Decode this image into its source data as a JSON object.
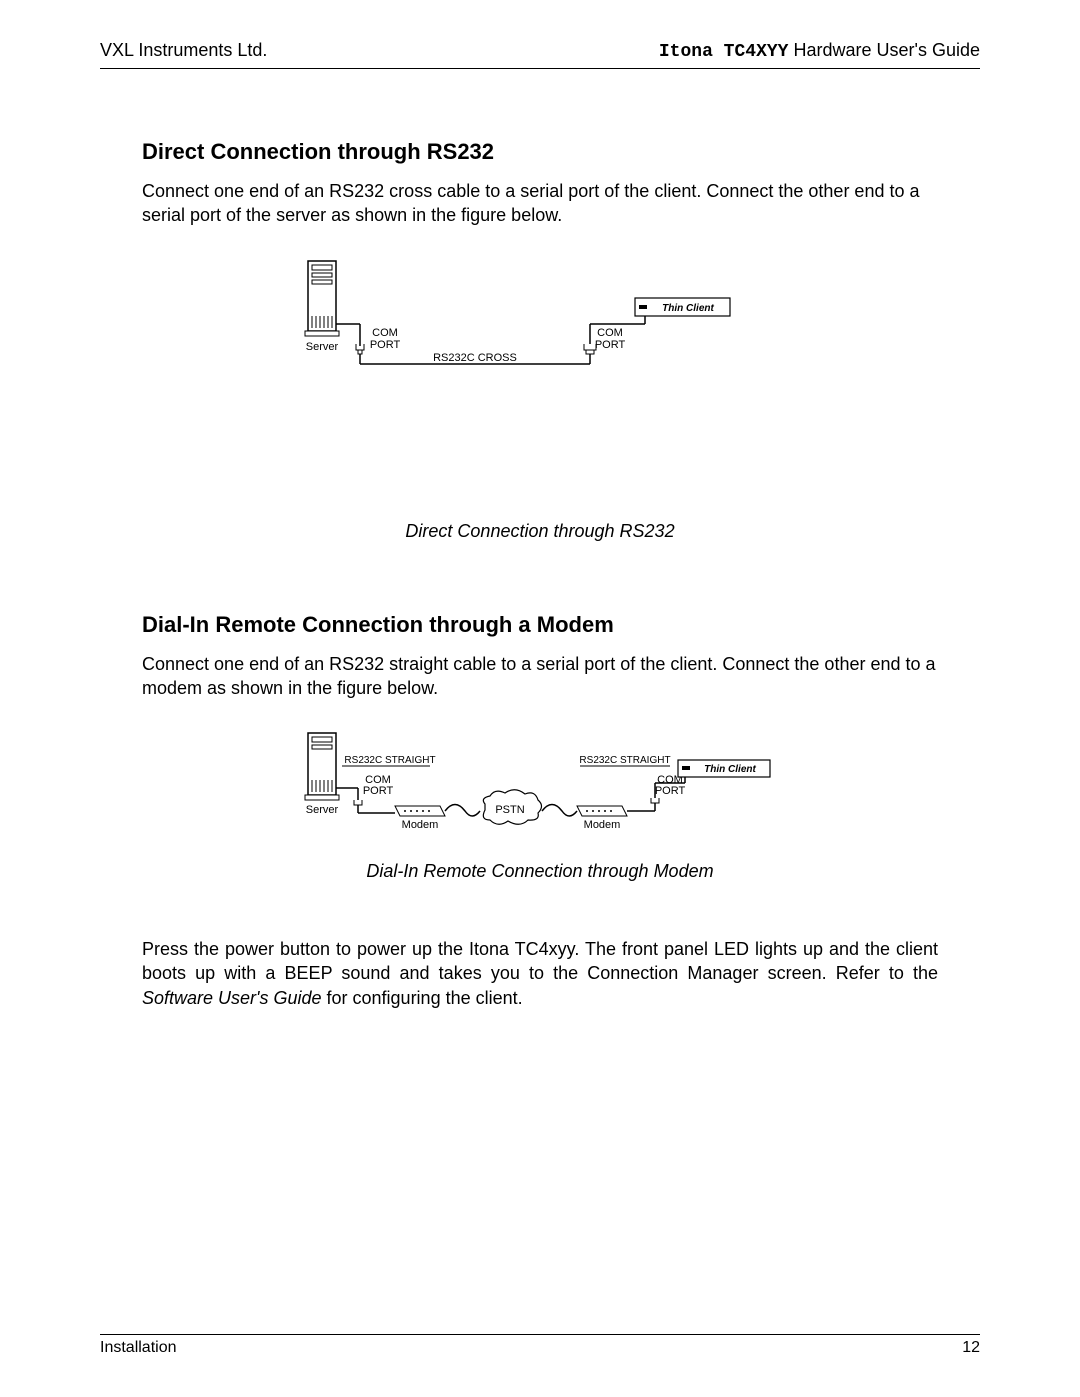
{
  "header": {
    "company": "VXL Instruments Ltd.",
    "product": "Itona TC4XYY",
    "docTitle": " Hardware User's Guide"
  },
  "section1": {
    "heading": "Direct Connection through RS232",
    "paragraph": "Connect one end of an RS232 cross cable to a serial port of the client.  Connect the other end to a serial port of the server as shown in the figure below.",
    "caption": "Direct Connection through RS232"
  },
  "figure1": {
    "serverLabel": "Server",
    "com1": "COM",
    "port1": "PORT",
    "cable": "RS232C CROSS",
    "com2": "COM",
    "port2": "PORT",
    "thinClient": "Thin Client"
  },
  "section2": {
    "heading": "Dial-In Remote Connection through a Modem",
    "paragraph": "Connect one end of an RS232 straight cable to a serial port of the client. Connect the other end to a modem as shown in the figure below.",
    "caption": "Dial-In Remote Connection through Modem"
  },
  "figure2": {
    "serverLabel": "Server",
    "cable1": "RS232C STRAIGHT",
    "com1": "COM",
    "port1": "PORT",
    "modem1": "Modem",
    "pstn": "PSTN",
    "modem2": "Modem",
    "cable2": "RS232C STRAIGHT",
    "com2": "COM",
    "port2": "PORT",
    "thinClient": "Thin Client"
  },
  "powerParagraph": {
    "part1": "Press the power button to power up the Itona TC4xyy. The front panel LED lights up and the client boots up with a BEEP sound and takes you to the Connection Manager screen. Refer to the ",
    "italic": "Software User's Guide",
    "part2": " for configuring the client."
  },
  "footer": {
    "section": "Installation",
    "pageNumber": "12"
  }
}
